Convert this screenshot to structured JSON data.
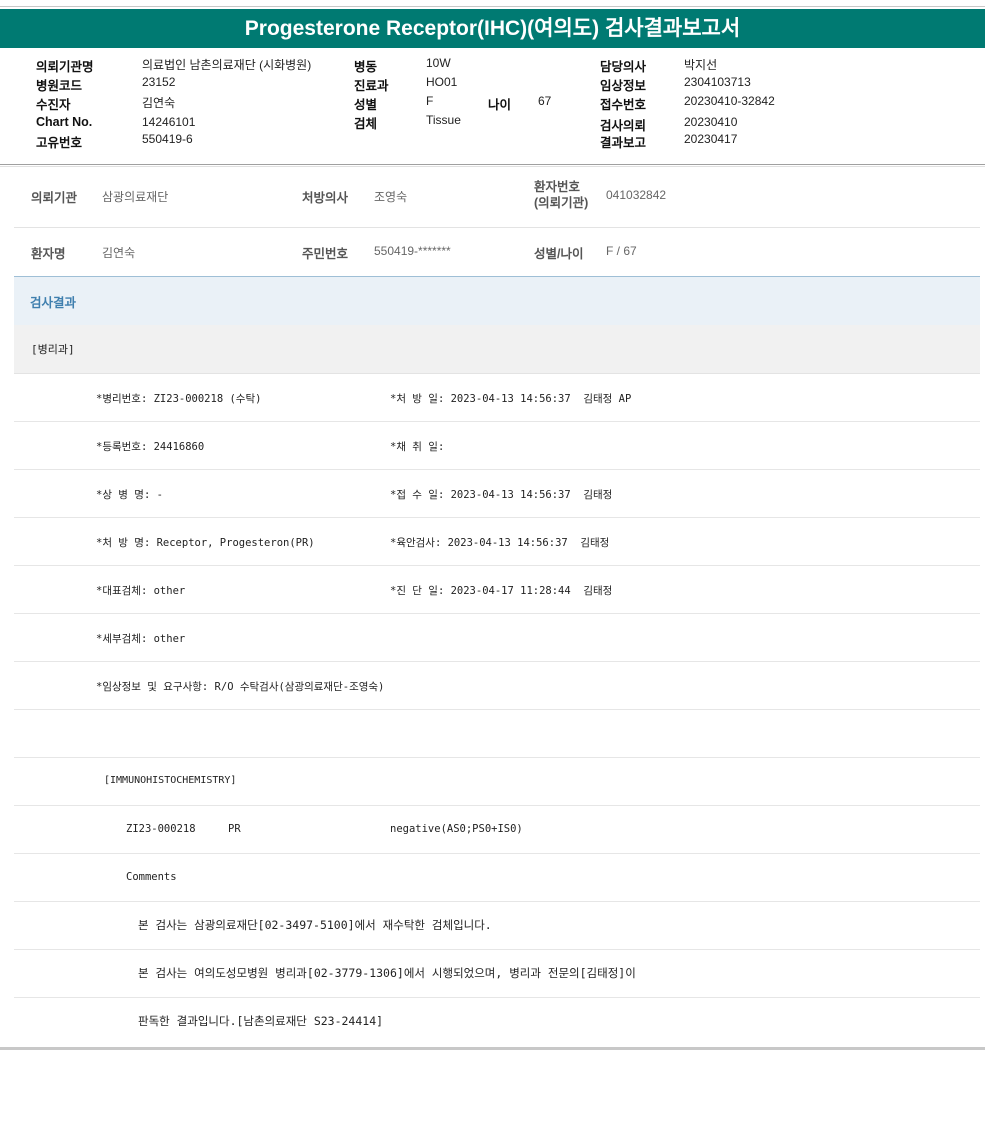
{
  "title": "Progesterone Receptor(IHC)(여의도) 검사결과보고서",
  "header": {
    "col1": [
      {
        "label": "의뢰기관명",
        "value": "의료법인 남촌의료재단 (시화병원)"
      },
      {
        "label": "병원코드",
        "value": "23152"
      },
      {
        "label": "수진자",
        "value": "김연숙"
      },
      {
        "label": "Chart No.",
        "value": "14246101"
      },
      {
        "label": "고유번호",
        "value": "550419-6"
      }
    ],
    "col2": [
      {
        "label": "병동",
        "value": "10W"
      },
      {
        "label": "진료과",
        "value": "HO01"
      },
      {
        "label": "성별",
        "value": "F"
      },
      {
        "label": "검체",
        "value": "Tissue"
      }
    ],
    "age_label": "나이",
    "age_value": "67",
    "col3": [
      {
        "label": "담당의사",
        "value": "박지선"
      },
      {
        "label": "임상정보",
        "value": "2304103713"
      },
      {
        "label": "접수번호",
        "value": "20230410-32842"
      },
      {
        "label": "검사의뢰",
        "value": "20230410"
      },
      {
        "label": "결과보고",
        "value": "20230417"
      }
    ]
  },
  "patient_info": {
    "row1": [
      {
        "label": "의뢰기관",
        "value": "삼광의료재단"
      },
      {
        "label": "처방의사",
        "value": "조영숙"
      },
      {
        "label": "환자번호\n(의뢰기관)",
        "value": "041032842"
      }
    ],
    "row2": [
      {
        "label": "환자명",
        "value": "김연숙"
      },
      {
        "label": "주민번호",
        "value": "550419-*******"
      },
      {
        "label": "성별/나이",
        "value": "F / 67"
      }
    ]
  },
  "results_title": "검사결과",
  "department": "[병리과]",
  "details": [
    {
      "left": "*병리번호: ZI23-000218 (수탁)",
      "right": "*처 방 일: 2023-04-13 14:56:37  김태정 AP"
    },
    {
      "left": "*등록번호: 24416860",
      "right": "*채 취 일:"
    },
    {
      "left": "*상 병 명: -",
      "right": "*접 수 일: 2023-04-13 14:56:37  김태정"
    },
    {
      "left": "*처 방 명: Receptor, Progesteron(PR)",
      "right": "*육안검사: 2023-04-13 14:56:37  김태정"
    },
    {
      "left": "*대표검체: other",
      "right": "*진 단 일: 2023-04-17 11:28:44  김태정"
    },
    {
      "left": "*세부검체: other",
      "right": ""
    },
    {
      "left": "*임상정보 및 요구사항: R/O 수탁검사(삼광의료재단-조영숙)",
      "right": ""
    }
  ],
  "ihc_header": "[IMMUNOHISTOCHEMISTRY]",
  "ihc_result": {
    "specimen": "ZI23-000218",
    "marker": "PR",
    "result": "negative(AS0;PS0+IS0)"
  },
  "comments_label": "Comments",
  "comments": [
    "본 검사는 삼광의료재단[02-3497-5100]에서 재수탁한 검체입니다.",
    "본 검사는 여의도성모병원 병리과[02-3779-1306]에서 시행되었으며, 병리과 전문의[김태정]이",
    "판독한 결과입니다.[남촌의료재단 S23-24414]"
  ]
}
